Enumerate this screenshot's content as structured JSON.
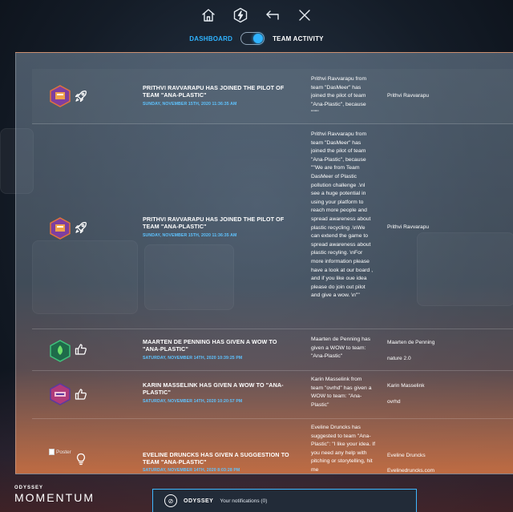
{
  "nav": {
    "icons": [
      "home-icon",
      "lightning-hex-icon",
      "back-arrow-icon",
      "close-icon"
    ]
  },
  "toggle": {
    "left_label": "DASHBOARD",
    "right_label": "TEAM ACTIVITY",
    "active": "TEAM ACTIVITY"
  },
  "colors": {
    "accent": "#2fb3ff",
    "date_text": "#5ec3ff",
    "panel_bottom": "#d7784a"
  },
  "activity": [
    {
      "avatar": "team-badge-purple-icon",
      "type_icon": "rocket-icon",
      "title": "PRITHVI RAVVARAPU HAS JOINED THE PILOT OF TEAM \"ANA-PLASTIC\"",
      "date": "SUNDAY, NOVEMBER 15TH, 2020 11:36:35 AM",
      "message": "Prithvi Ravvarapu from team \"DasMeer\" has joined the pilot of team \"Ana-Plastic\", because \"\"\"\"",
      "name": "Prithvi Ravvarapu",
      "extra": ""
    },
    {
      "avatar": "team-badge-purple-icon",
      "type_icon": "rocket-icon",
      "title": "PRITHVI RAVVARAPU HAS JOINED THE PILOT OF TEAM \"ANA-PLASTIC\"",
      "date": "SUNDAY, NOVEMBER 15TH, 2020 11:36:35 AM",
      "message": "Prithvi Ravvarapu from team \"DasMeer\" has joined the pilot of team \"Ana-Plastic\", because \"\"We are from Team DasMeer of Plastic pollution challenge .\\nI see a huge potential in using your platform to reach more people and spread awareness about plastic recycling .\\nWe can extend the game to spread awareness about plastic recyling. \\nFor more information please have a look at our board , and if you like oue idea please do join out pilot and give a wow. \\n\"\"",
      "name": "Prithvi Ravvarapu",
      "extra": ""
    },
    {
      "avatar": "team-badge-green-icon",
      "type_icon": "thumbs-up-icon",
      "title": "MAARTEN DE PENNING HAS GIVEN A WOW TO \"ANA-PLASTIC\"",
      "date": "SATURDAY, NOVEMBER 14TH, 2020 10:39:25 PM",
      "message": "Maarten de Penning has given a WOW to team: \"Ana-Plastic\"",
      "name": "Maarten de Penning",
      "extra": "nature 2.0"
    },
    {
      "avatar": "team-badge-pink-icon",
      "type_icon": "thumbs-up-icon",
      "title": "KARIN MASSELINK HAS GIVEN A WOW TO \"ANA-PLASTIC\"",
      "date": "SATURDAY, NOVEMBER 14TH, 2020 10:20:57 PM",
      "message": "Karin Masselink from team \"ovrhd\" has given a WOW to team: \"Ana-Plastic\"",
      "name": "Karin Masselink",
      "extra": "ovrhd"
    },
    {
      "avatar": "Poster",
      "type_icon": "lightbulb-icon",
      "title": "EVELINE DRUNCKS HAS GIVEN A SUGGESTION TO TEAM \"ANA-PLASTIC\"",
      "date": "SATURDAY, NOVEMBER 14TH, 2020 8:03:28 PM",
      "message": "Eveline Druncks has suggested to team \"Ana-Plastic\": \"I like your idea. If you need any help with pitching or storytelling, hit me",
      "name": "Eveline Druncks",
      "extra": "Evelinedruncks.com"
    }
  ],
  "footer": {
    "brand_small": "ODYSSEY",
    "brand_large": "MOMENTUM",
    "bar_brand": "ODYSSEY",
    "notifications": "Your notifications (0)"
  }
}
